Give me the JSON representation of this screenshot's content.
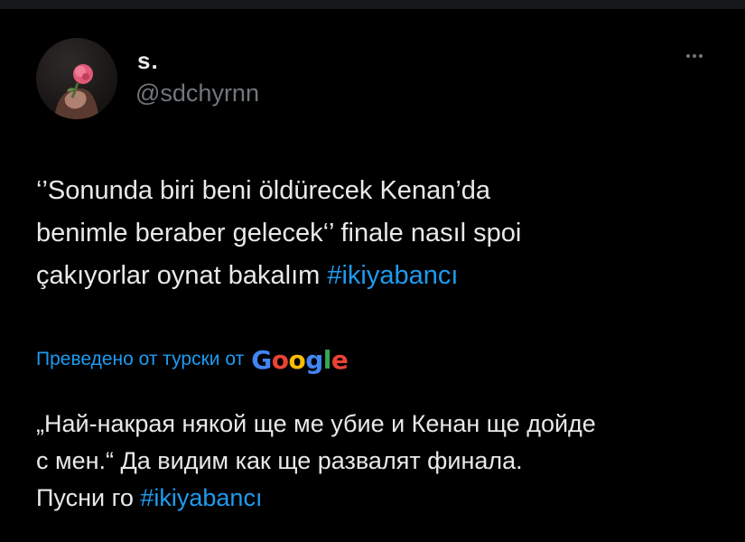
{
  "tweet": {
    "author": {
      "display_name": "s.",
      "handle": "@sdchyrnn",
      "avatar_icon": "avatar-rose-in-hand"
    },
    "more_icon": "more-horizontal-icon",
    "text_lines": [
      "‘’Sonunda biri beni öldürecek Kenan’da",
      "benimle beraber gelecek‘’ finale nasıl spoi",
      "çakıyorlar oynat bakalım "
    ],
    "hashtag": "#ikiyabancı",
    "translation": {
      "label": "Преведено от турски от",
      "provider_letters": [
        "G",
        "o",
        "o",
        "g",
        "l",
        "e"
      ],
      "lines": [
        "„Най-накрая някой ще ме убие и Кенан ще дойде",
        "с мен.“ Да видим как ще развалят финала.",
        "Пусни го "
      ],
      "hashtag": "#ikiyabancı"
    }
  },
  "colors": {
    "background": "#000000",
    "text": "#e7e9ea",
    "secondary_text": "#71767b",
    "link": "#1d9bf0",
    "google": [
      "#4285f4",
      "#ea4335",
      "#fbbc05",
      "#4285f4",
      "#34a853",
      "#ea4335"
    ]
  }
}
